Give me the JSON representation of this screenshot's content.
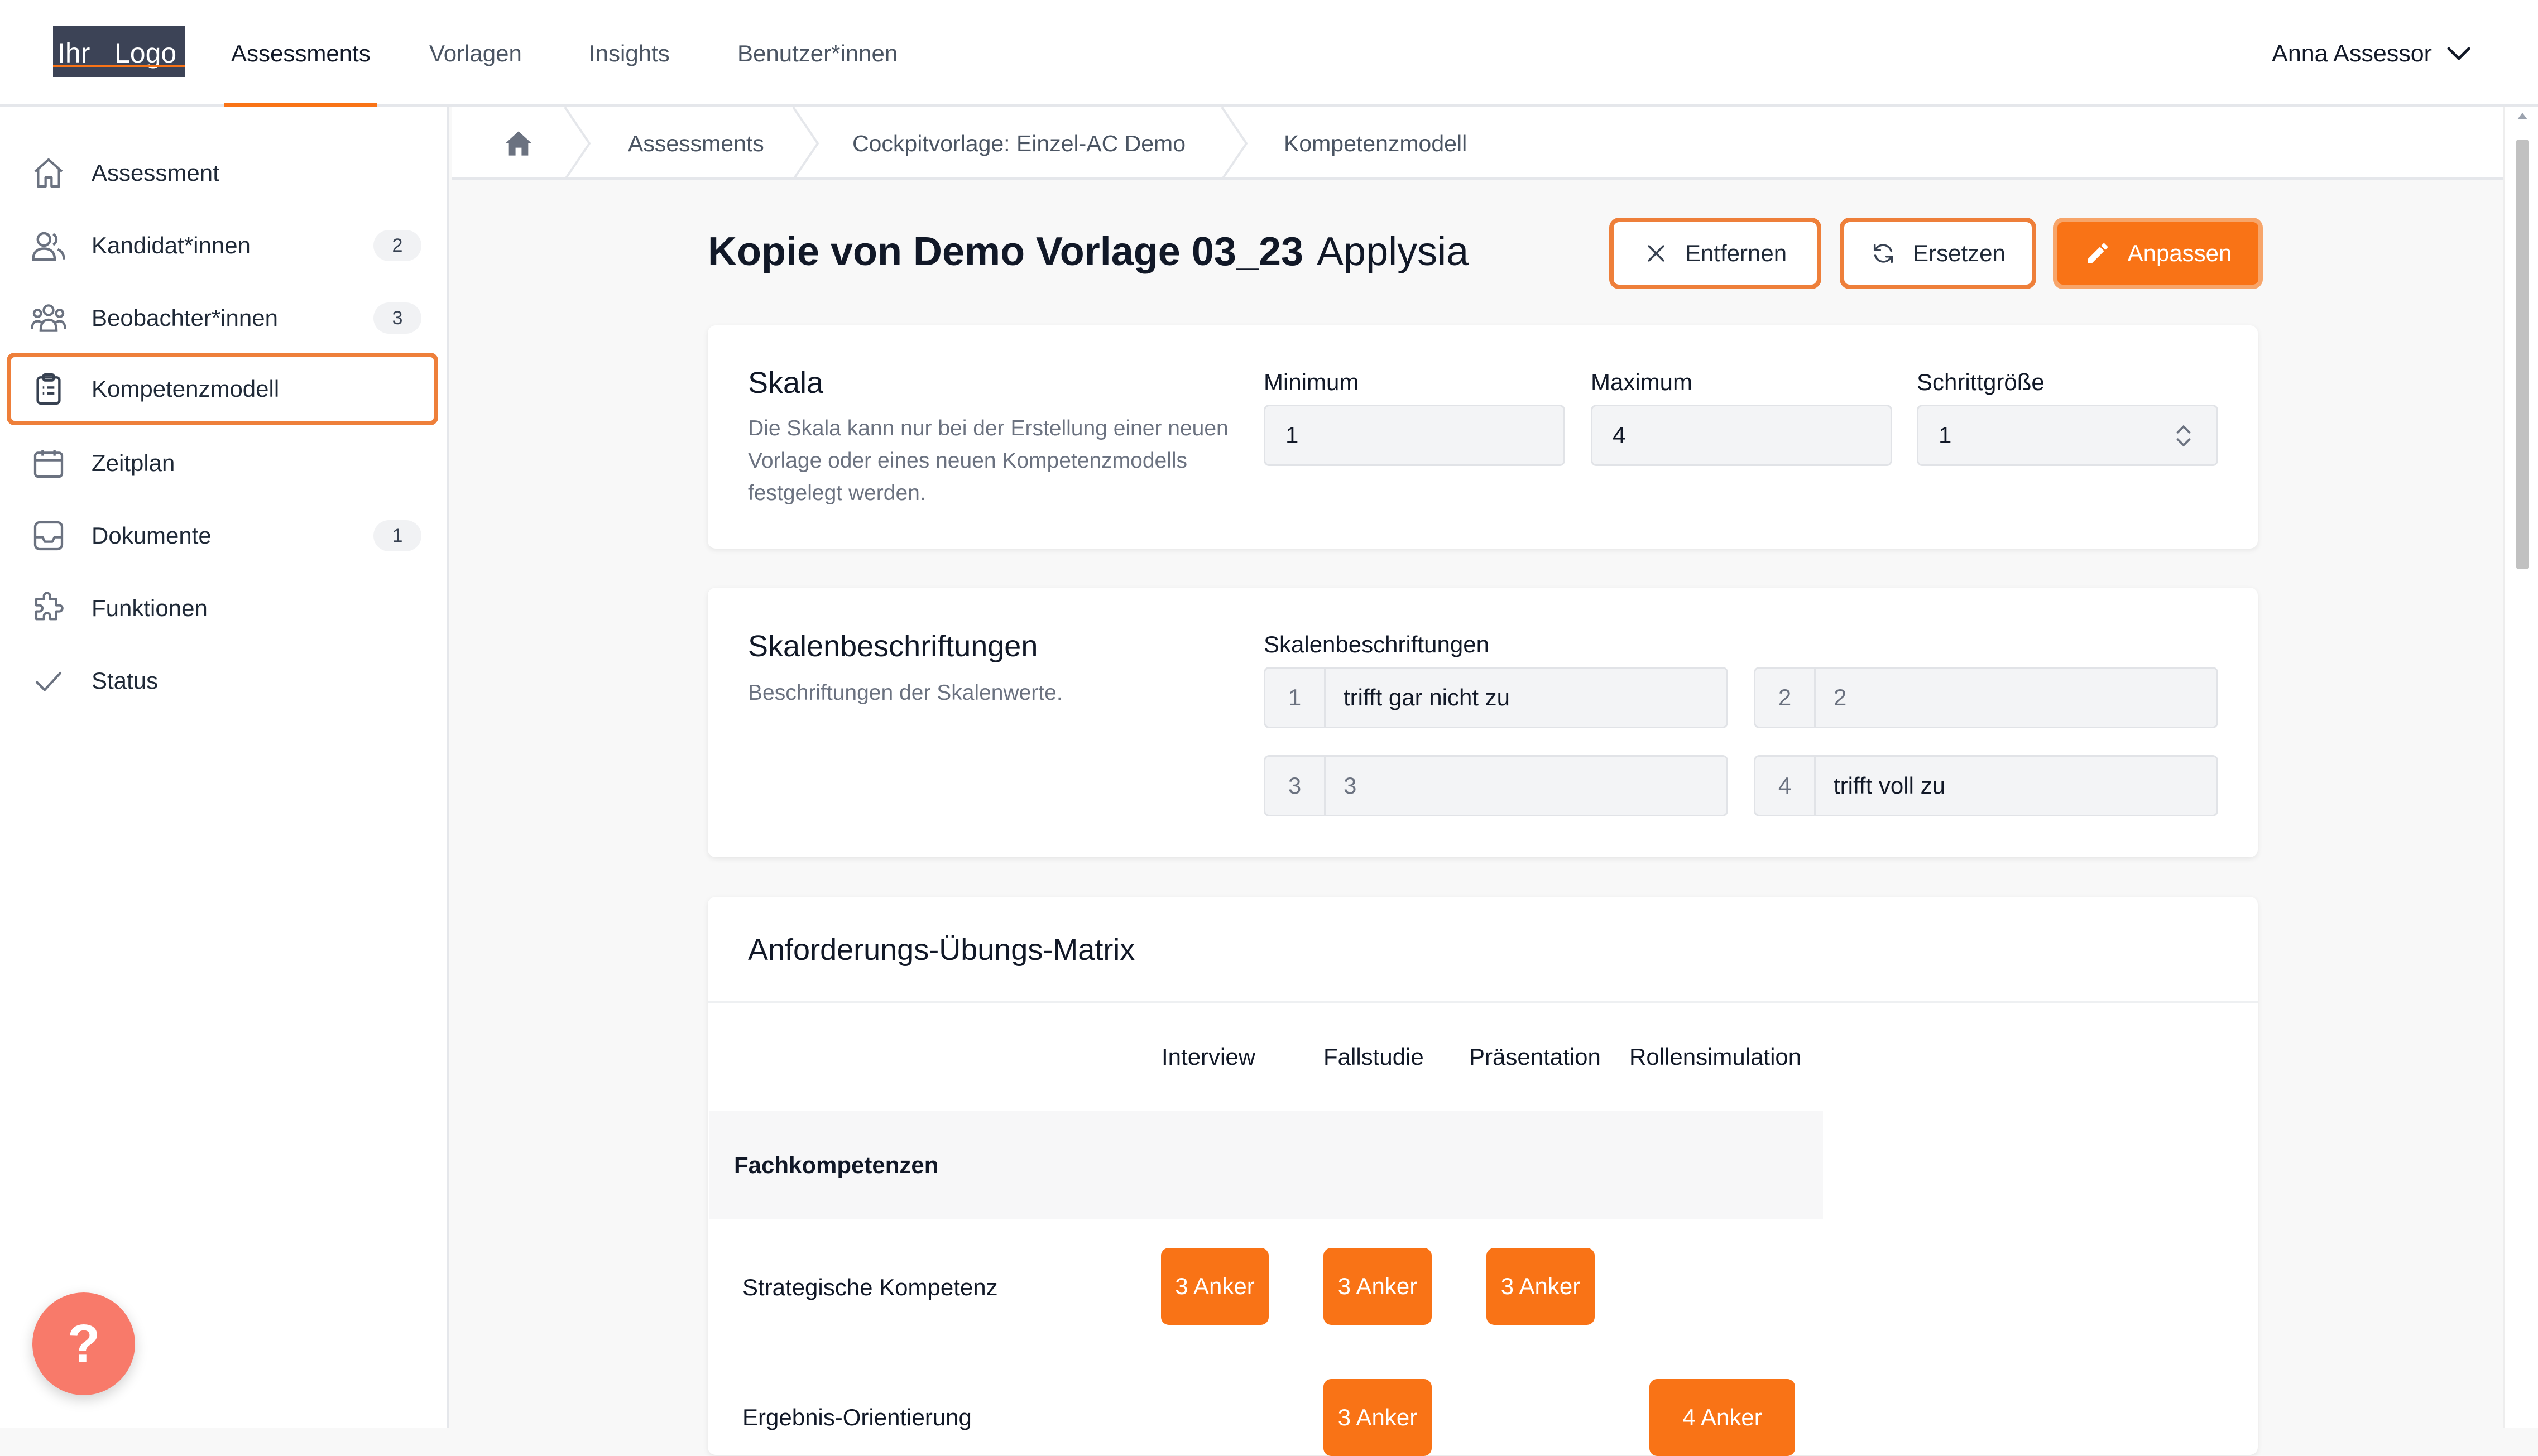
{
  "header": {
    "logo_left": "Ihr",
    "logo_right": "Logo",
    "nav": [
      "Assessments",
      "Vorlagen",
      "Insights",
      "Benutzer*innen"
    ],
    "active_nav": "Assessments",
    "user": "Anna Assessor"
  },
  "sidebar": {
    "items": [
      {
        "label": "Assessment",
        "icon": "home-icon"
      },
      {
        "label": "Kandidat*innen",
        "icon": "users-icon",
        "count": "2"
      },
      {
        "label": "Beobachter*innen",
        "icon": "user-group-icon",
        "count": "3"
      },
      {
        "label": "Kompetenzmodell",
        "icon": "clipboard-icon",
        "active": true
      },
      {
        "label": "Zeitplan",
        "icon": "calendar-icon"
      },
      {
        "label": "Dokumente",
        "icon": "inbox-icon",
        "count": "1"
      },
      {
        "label": "Funktionen",
        "icon": "puzzle-icon"
      },
      {
        "label": "Status",
        "icon": "check-icon"
      }
    ]
  },
  "breadcrumb": [
    "Assessments",
    "Cockpitvorlage: Einzel-AC Demo",
    "Kompetenzmodell"
  ],
  "page": {
    "title": "Kopie von Demo Vorlage 03_23",
    "subtitle": "Applysia",
    "buttons": {
      "remove": "Entfernen",
      "replace": "Ersetzen",
      "customize": "Anpassen"
    }
  },
  "scale": {
    "title": "Skala",
    "description": "Die Skala kann nur bei der Erstellung einer neuen Vorlage oder eines neuen Kompetenzmodells festgelegt werden.",
    "min_label": "Minimum",
    "min_value": "1",
    "max_label": "Maximum",
    "max_value": "4",
    "step_label": "Schrittgröße",
    "step_value": "1"
  },
  "scale_labels": {
    "title": "Skalenbeschriftungen",
    "description": "Beschriftungen der Skalenwerte.",
    "field_label": "Skalenbeschriftungen",
    "rows": [
      {
        "num": "1",
        "text": "trifft gar nicht zu"
      },
      {
        "num": "2",
        "text": "2"
      },
      {
        "num": "3",
        "text": "3"
      },
      {
        "num": "4",
        "text": "trifft voll zu"
      }
    ]
  },
  "matrix": {
    "title": "Anforderungs-Übungs-Matrix",
    "columns": [
      "Interview",
      "Fallstudie",
      "Präsentation",
      "Rollensimulation"
    ],
    "group": "Fachkompetenzen",
    "rows": [
      {
        "label": "Strategische Kompetenz",
        "anchors": [
          "3 Anker",
          "3 Anker",
          "3 Anker",
          ""
        ]
      },
      {
        "label": "Ergebnis-Orientierung",
        "anchors": [
          "",
          "3 Anker",
          "",
          "4 Anker"
        ]
      }
    ]
  },
  "help_label": "?",
  "colors": {
    "accent": "#f97316",
    "accent_border": "#ee7f3a",
    "help": "#f87a6a"
  }
}
